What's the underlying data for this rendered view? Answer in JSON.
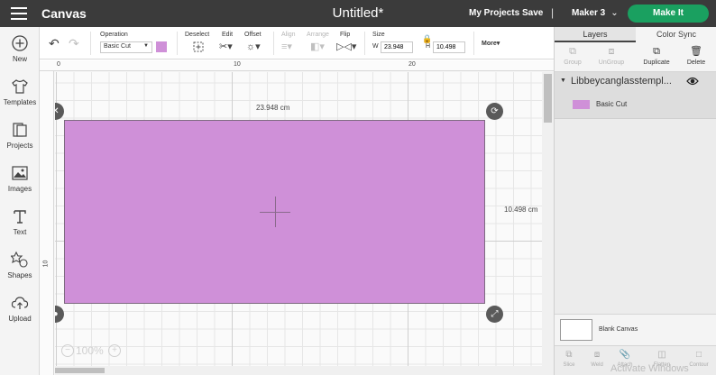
{
  "header": {
    "app_title": "Canvas",
    "doc_title": "Untitled*",
    "my_projects": "My Projects",
    "save": "Save",
    "separator": "|",
    "machine": "Maker 3",
    "make_it": "Make It"
  },
  "sidebar": {
    "items": [
      {
        "label": "New",
        "icon": "plus-circle-icon"
      },
      {
        "label": "Templates",
        "icon": "shirt-icon"
      },
      {
        "label": "Projects",
        "icon": "folder-icon"
      },
      {
        "label": "Images",
        "icon": "image-icon"
      },
      {
        "label": "Text",
        "icon": "text-icon"
      },
      {
        "label": "Shapes",
        "icon": "shapes-icon"
      },
      {
        "label": "Upload",
        "icon": "cloud-upload-icon"
      }
    ]
  },
  "toolbar": {
    "operation_label": "Operation",
    "operation_value": "Basic Cut",
    "operation_color": "#cf90d8",
    "deselect": "Deselect",
    "edit": "Edit",
    "offset": "Offset",
    "align": "Align",
    "arrange": "Arrange",
    "flip": "Flip",
    "size": "Size",
    "width_label": "W",
    "width_value": "23.948",
    "height_label": "H",
    "height_value": "10.498",
    "more": "More"
  },
  "canvas": {
    "ruler_top": [
      "0",
      "10",
      "20"
    ],
    "ruler_left": [
      "10"
    ],
    "width_dim": "23.948 cm",
    "height_dim": "10.498 cm",
    "zoom": "100%",
    "shape_color": "#cf90d8"
  },
  "layers_panel": {
    "tabs": [
      "Layers",
      "Color Sync"
    ],
    "actions": [
      "Group",
      "UnGroup",
      "Duplicate",
      "Delete"
    ],
    "group_name": "Libbeycanglasstempl...",
    "layer_name": "Basic Cut",
    "layer_color": "#cf90d8",
    "blank_canvas": "Blank Canvas",
    "bottom_actions": [
      "Slice",
      "Weld",
      "Attach",
      "Flatten",
      "Contour"
    ],
    "watermark": "Activate Windows"
  },
  "colors": {
    "header_bg": "#3b3b3b",
    "make_it": "#1aa060",
    "shape_fill": "#cf90d8"
  }
}
